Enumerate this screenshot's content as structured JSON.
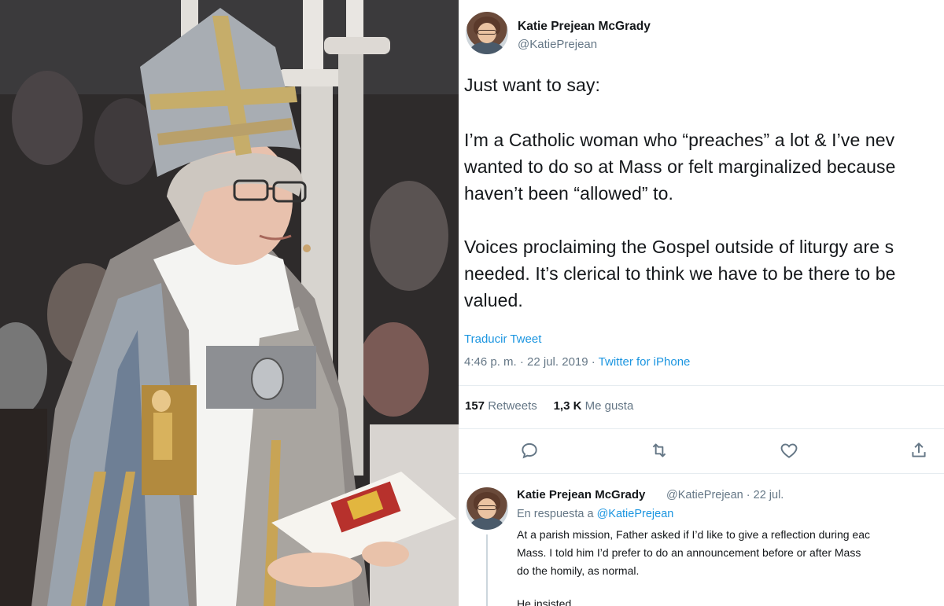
{
  "tweet": {
    "author_name": "Katie Prejean McGrady",
    "author_handle": "@KatiePrejean",
    "body_lines": [
      "Just want to say:",
      "I’m a Catholic woman who “preaches” a lot & I’ve nev",
      "wanted to do so at Mass or felt marginalized because",
      "haven’t been “allowed” to.",
      "Voices proclaiming the Gospel outside of liturgy are s",
      "needed. It’s clerical to think we have to be there to be",
      "valued."
    ],
    "translate_label": "Traducir Tweet",
    "timestamp": "4:46 p. m. · 22 jul. 2019 · ",
    "client": "Twitter for iPhone",
    "retweets_count": "157",
    "retweets_label": "Retweets",
    "likes_count": "1,3 K",
    "likes_label": "Me gusta"
  },
  "reply": {
    "author_name": "Katie Prejean McGrady",
    "author_handle_date": "@KatiePrejean · 22 jul.",
    "in_reply_prefix": "En respuesta a ",
    "in_reply_handle": "@KatiePrejean",
    "lines": [
      "At a parish mission, Father asked if I’d like to give a reflection during eac",
      "Mass. I told him I’d prefer to do an announcement before or after Mass",
      "do the homily, as normal.",
      "",
      "He insisted."
    ]
  },
  "icons": {
    "reply": "reply-icon",
    "retweet": "retweet-icon",
    "like": "heart-icon",
    "share": "share-icon"
  },
  "colors": {
    "link": "#1b95e0",
    "muted": "#657786",
    "text": "#14171a",
    "divider": "#e6ecf0"
  }
}
